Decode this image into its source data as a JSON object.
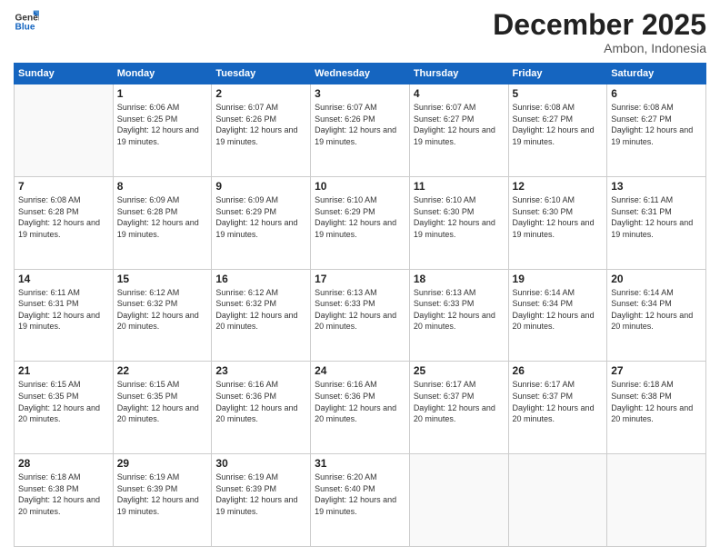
{
  "header": {
    "logo_line1": "General",
    "logo_line2": "Blue",
    "month_year": "December 2025",
    "location": "Ambon, Indonesia"
  },
  "days_of_week": [
    "Sunday",
    "Monday",
    "Tuesday",
    "Wednesday",
    "Thursday",
    "Friday",
    "Saturday"
  ],
  "weeks": [
    [
      {
        "day": "",
        "sunrise": "",
        "sunset": "",
        "daylight": ""
      },
      {
        "day": "1",
        "sunrise": "Sunrise: 6:06 AM",
        "sunset": "Sunset: 6:25 PM",
        "daylight": "Daylight: 12 hours and 19 minutes."
      },
      {
        "day": "2",
        "sunrise": "Sunrise: 6:07 AM",
        "sunset": "Sunset: 6:26 PM",
        "daylight": "Daylight: 12 hours and 19 minutes."
      },
      {
        "day": "3",
        "sunrise": "Sunrise: 6:07 AM",
        "sunset": "Sunset: 6:26 PM",
        "daylight": "Daylight: 12 hours and 19 minutes."
      },
      {
        "day": "4",
        "sunrise": "Sunrise: 6:07 AM",
        "sunset": "Sunset: 6:27 PM",
        "daylight": "Daylight: 12 hours and 19 minutes."
      },
      {
        "day": "5",
        "sunrise": "Sunrise: 6:08 AM",
        "sunset": "Sunset: 6:27 PM",
        "daylight": "Daylight: 12 hours and 19 minutes."
      },
      {
        "day": "6",
        "sunrise": "Sunrise: 6:08 AM",
        "sunset": "Sunset: 6:27 PM",
        "daylight": "Daylight: 12 hours and 19 minutes."
      }
    ],
    [
      {
        "day": "7",
        "sunrise": "Sunrise: 6:08 AM",
        "sunset": "Sunset: 6:28 PM",
        "daylight": "Daylight: 12 hours and 19 minutes."
      },
      {
        "day": "8",
        "sunrise": "Sunrise: 6:09 AM",
        "sunset": "Sunset: 6:28 PM",
        "daylight": "Daylight: 12 hours and 19 minutes."
      },
      {
        "day": "9",
        "sunrise": "Sunrise: 6:09 AM",
        "sunset": "Sunset: 6:29 PM",
        "daylight": "Daylight: 12 hours and 19 minutes."
      },
      {
        "day": "10",
        "sunrise": "Sunrise: 6:10 AM",
        "sunset": "Sunset: 6:29 PM",
        "daylight": "Daylight: 12 hours and 19 minutes."
      },
      {
        "day": "11",
        "sunrise": "Sunrise: 6:10 AM",
        "sunset": "Sunset: 6:30 PM",
        "daylight": "Daylight: 12 hours and 19 minutes."
      },
      {
        "day": "12",
        "sunrise": "Sunrise: 6:10 AM",
        "sunset": "Sunset: 6:30 PM",
        "daylight": "Daylight: 12 hours and 19 minutes."
      },
      {
        "day": "13",
        "sunrise": "Sunrise: 6:11 AM",
        "sunset": "Sunset: 6:31 PM",
        "daylight": "Daylight: 12 hours and 19 minutes."
      }
    ],
    [
      {
        "day": "14",
        "sunrise": "Sunrise: 6:11 AM",
        "sunset": "Sunset: 6:31 PM",
        "daylight": "Daylight: 12 hours and 19 minutes."
      },
      {
        "day": "15",
        "sunrise": "Sunrise: 6:12 AM",
        "sunset": "Sunset: 6:32 PM",
        "daylight": "Daylight: 12 hours and 20 minutes."
      },
      {
        "day": "16",
        "sunrise": "Sunrise: 6:12 AM",
        "sunset": "Sunset: 6:32 PM",
        "daylight": "Daylight: 12 hours and 20 minutes."
      },
      {
        "day": "17",
        "sunrise": "Sunrise: 6:13 AM",
        "sunset": "Sunset: 6:33 PM",
        "daylight": "Daylight: 12 hours and 20 minutes."
      },
      {
        "day": "18",
        "sunrise": "Sunrise: 6:13 AM",
        "sunset": "Sunset: 6:33 PM",
        "daylight": "Daylight: 12 hours and 20 minutes."
      },
      {
        "day": "19",
        "sunrise": "Sunrise: 6:14 AM",
        "sunset": "Sunset: 6:34 PM",
        "daylight": "Daylight: 12 hours and 20 minutes."
      },
      {
        "day": "20",
        "sunrise": "Sunrise: 6:14 AM",
        "sunset": "Sunset: 6:34 PM",
        "daylight": "Daylight: 12 hours and 20 minutes."
      }
    ],
    [
      {
        "day": "21",
        "sunrise": "Sunrise: 6:15 AM",
        "sunset": "Sunset: 6:35 PM",
        "daylight": "Daylight: 12 hours and 20 minutes."
      },
      {
        "day": "22",
        "sunrise": "Sunrise: 6:15 AM",
        "sunset": "Sunset: 6:35 PM",
        "daylight": "Daylight: 12 hours and 20 minutes."
      },
      {
        "day": "23",
        "sunrise": "Sunrise: 6:16 AM",
        "sunset": "Sunset: 6:36 PM",
        "daylight": "Daylight: 12 hours and 20 minutes."
      },
      {
        "day": "24",
        "sunrise": "Sunrise: 6:16 AM",
        "sunset": "Sunset: 6:36 PM",
        "daylight": "Daylight: 12 hours and 20 minutes."
      },
      {
        "day": "25",
        "sunrise": "Sunrise: 6:17 AM",
        "sunset": "Sunset: 6:37 PM",
        "daylight": "Daylight: 12 hours and 20 minutes."
      },
      {
        "day": "26",
        "sunrise": "Sunrise: 6:17 AM",
        "sunset": "Sunset: 6:37 PM",
        "daylight": "Daylight: 12 hours and 20 minutes."
      },
      {
        "day": "27",
        "sunrise": "Sunrise: 6:18 AM",
        "sunset": "Sunset: 6:38 PM",
        "daylight": "Daylight: 12 hours and 20 minutes."
      }
    ],
    [
      {
        "day": "28",
        "sunrise": "Sunrise: 6:18 AM",
        "sunset": "Sunset: 6:38 PM",
        "daylight": "Daylight: 12 hours and 20 minutes."
      },
      {
        "day": "29",
        "sunrise": "Sunrise: 6:19 AM",
        "sunset": "Sunset: 6:39 PM",
        "daylight": "Daylight: 12 hours and 19 minutes."
      },
      {
        "day": "30",
        "sunrise": "Sunrise: 6:19 AM",
        "sunset": "Sunset: 6:39 PM",
        "daylight": "Daylight: 12 hours and 19 minutes."
      },
      {
        "day": "31",
        "sunrise": "Sunrise: 6:20 AM",
        "sunset": "Sunset: 6:40 PM",
        "daylight": "Daylight: 12 hours and 19 minutes."
      },
      {
        "day": "",
        "sunrise": "",
        "sunset": "",
        "daylight": ""
      },
      {
        "day": "",
        "sunrise": "",
        "sunset": "",
        "daylight": ""
      },
      {
        "day": "",
        "sunrise": "",
        "sunset": "",
        "daylight": ""
      }
    ]
  ]
}
